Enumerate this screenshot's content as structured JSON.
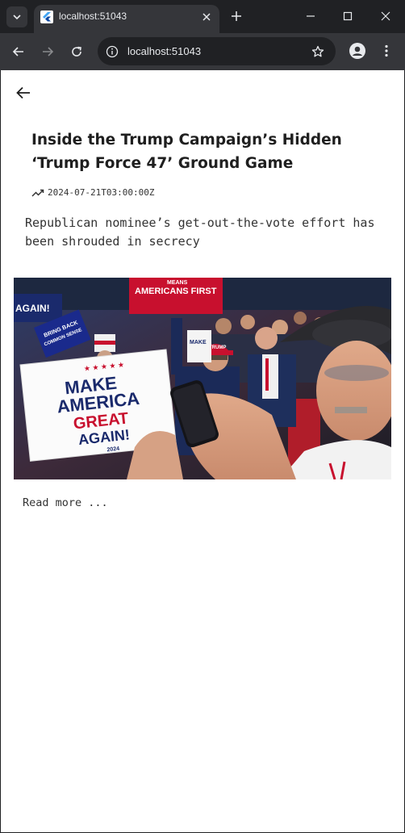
{
  "browser": {
    "tab": {
      "title": "localhost:51043"
    },
    "omnibox": {
      "url": "localhost:51043"
    }
  },
  "article": {
    "headline": "Inside the Trump Campaign’s Hidden ‘Trump Force 47’ Ground Game",
    "timestamp": "2024-07-21T03:00:00Z",
    "summary": "Republican nominee’s get-out-the-vote effort has been shrouded in secrecy",
    "read_more": "Read more ...",
    "hero_image": {
      "signs": {
        "top": "MEANS",
        "top_main": "AMERICANS FIRST",
        "left_banner": "AGAIN!",
        "blue_sign_1": "BRING BACK",
        "blue_sign_2": "COMMON SENSE",
        "main_1": "MAKE",
        "main_2": "AMERICA",
        "main_3": "GREAT",
        "main_4": "AGAIN!",
        "main_year": "2024",
        "small_sign": "MAKE",
        "cap": "TRUMP"
      }
    }
  },
  "colors": {
    "chrome_dark": "#202124",
    "chrome_tab": "#35363a",
    "page_bg": "#ffffff",
    "text": "#1f1f1f",
    "maga_red": "#c8102e",
    "maga_navy": "#1a2a6c"
  }
}
